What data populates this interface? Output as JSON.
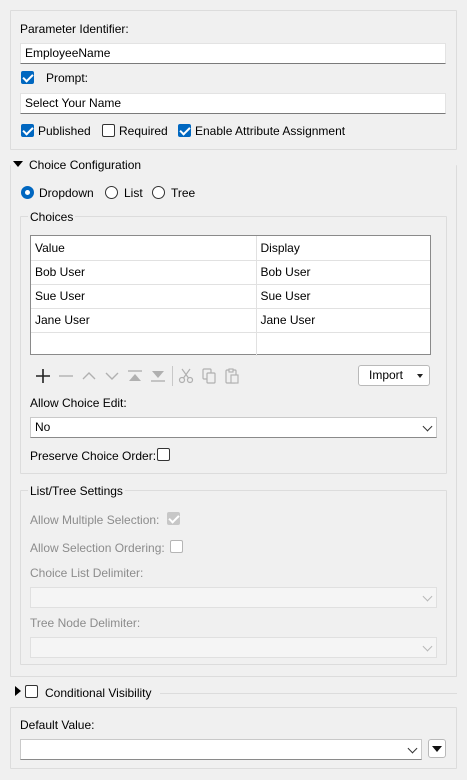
{
  "parameter": {
    "identifier_label": "Parameter Identifier:",
    "identifier_value": "EmployeeName",
    "prompt_label": "Prompt:",
    "prompt_checked": true,
    "prompt_value": "Select Your Name",
    "published_label": "Published",
    "published_checked": true,
    "required_label": "Required",
    "required_checked": false,
    "enable_attr_label": "Enable Attribute Assignment",
    "enable_attr_checked": true
  },
  "choice_config": {
    "section_label": "Choice Configuration",
    "type_options": [
      "Dropdown",
      "List",
      "Tree"
    ],
    "selected_type": "Dropdown",
    "choices_group_label": "Choices",
    "table": {
      "headers": [
        "Value",
        "Display"
      ],
      "rows": [
        [
          "Bob User",
          "Bob User"
        ],
        [
          "Sue User",
          "Sue User"
        ],
        [
          "Jane User",
          "Jane User"
        ]
      ]
    },
    "import_label": "Import",
    "allow_edit_label": "Allow Choice Edit:",
    "allow_edit_value": "No",
    "preserve_order_label": "Preserve Choice Order:",
    "preserve_order_checked": false
  },
  "list_tree": {
    "group_label": "List/Tree Settings",
    "allow_multiple_label": "Allow Multiple Selection:",
    "allow_ordering_label": "Allow Selection Ordering:",
    "list_delim_label": "Choice List Delimiter:",
    "tree_delim_label": "Tree Node Delimiter:"
  },
  "conditional_visibility_label": "Conditional Visibility",
  "default_value_label": "Default Value:",
  "colors": {
    "accent": "#0067c0",
    "background": "#f0f0f0"
  },
  "icons": [
    "add-icon",
    "remove-icon",
    "move-up-icon",
    "move-down-icon",
    "move-top-icon",
    "move-bottom-icon",
    "cut-icon",
    "copy-icon",
    "paste-icon"
  ]
}
